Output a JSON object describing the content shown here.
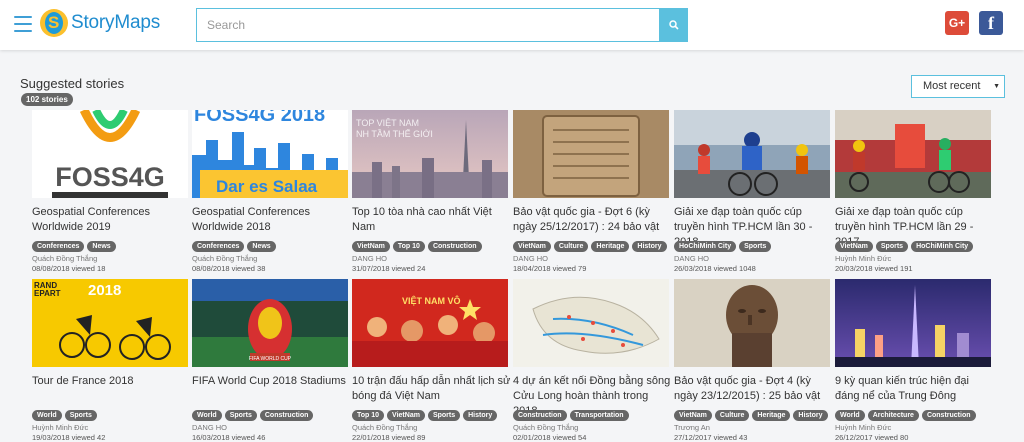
{
  "app": {
    "name": "StoryMaps"
  },
  "header": {
    "search": {
      "placeholder": "Search"
    },
    "social": {
      "gplus_label": "G+",
      "facebook_label": "f"
    }
  },
  "section": {
    "title": "Suggested stories",
    "count_badge": "102 stories",
    "sort": {
      "selected": "Most recent"
    }
  },
  "stories": [
    {
      "title": "Geospatial Conferences Worldwide 2019",
      "tags": [
        "Conferences",
        "News"
      ],
      "author": "Quách Đồng Thắng",
      "meta": "08/08/2018 viewed 18",
      "thumb": "foss4g"
    },
    {
      "title": "Geospatial Conferences Worldwide 2018",
      "tags": [
        "Conferences",
        "News"
      ],
      "author": "Quách Đồng Thắng",
      "meta": "08/08/2018 viewed 38",
      "thumb": "daressalaam"
    },
    {
      "title": "Top 10 tòa nhà cao nhất Việt Nam",
      "tags": [
        "VietNam",
        "Top 10",
        "Construction"
      ],
      "author": "DANG HO",
      "meta": "31/07/2018 viewed 24",
      "thumb": "skyline"
    },
    {
      "title": "Bảo vật quốc gia - Đợt 6 (kỳ ngày 25/12/2017) : 24 bảo vật",
      "tags": [
        "VietNam",
        "Culture",
        "Heritage",
        "History"
      ],
      "author": "DANG HO",
      "meta": "18/04/2018 viewed 79",
      "thumb": "artifact"
    },
    {
      "title": "Giải xe đạp toàn quốc cúp truyền hình TP.HCM lần 30 - 2018",
      "tags": [
        "HoChiMinh City",
        "Sports"
      ],
      "author": "DANG HO",
      "meta": "26/03/2018 viewed 1048",
      "thumb": "cycling1"
    },
    {
      "title": "Giải xe đạp toàn quốc cúp truyền hình TP.HCM lần 29 - 2017",
      "tags": [
        "VietNam",
        "Sports",
        "HoChiMinh City"
      ],
      "author": "Huỳnh Minh Đức",
      "meta": "20/03/2018 viewed 191",
      "thumb": "cycling2"
    },
    {
      "title": "Tour de France 2018",
      "tags": [
        "World",
        "Sports"
      ],
      "author": "Huỳnh Minh Đức",
      "meta": "19/03/2018 viewed 42",
      "thumb": "tdf"
    },
    {
      "title": "FIFA World Cup 2018 Stadiums",
      "tags": [
        "World",
        "Sports",
        "Construction"
      ],
      "author": "DANG HO",
      "meta": "16/03/2018 viewed 46",
      "thumb": "fifa"
    },
    {
      "title": "10 trận đấu hấp dẫn nhất lịch sử bóng đá Việt Nam",
      "tags": [
        "Top 10",
        "VietNam",
        "Sports",
        "History"
      ],
      "author": "Quách Đồng Thắng",
      "meta": "22/01/2018 viewed 89",
      "thumb": "fans"
    },
    {
      "title": "4 dự án kết nối Đồng bằng sông Cửu Long hoàn thành trong 2018",
      "tags": [
        "Construction",
        "Transportation"
      ],
      "author": "Quách Đồng Thắng",
      "meta": "02/01/2018 viewed 54",
      "thumb": "map"
    },
    {
      "title": "Bảo vật quốc gia - Đợt 4 (kỳ ngày 23/12/2015) : 25 bảo vật",
      "tags": [
        "VietNam",
        "Culture",
        "Heritage",
        "History"
      ],
      "author": "Trương An",
      "meta": "27/12/2017 viewed 43",
      "thumb": "statue"
    },
    {
      "title": "9 kỳ quan kiến trúc hiện đại đáng nể của Trung Đông",
      "tags": [
        "World",
        "Architecture",
        "Construction"
      ],
      "author": "Huỳnh Minh Đức",
      "meta": "26/12/2017 viewed 80",
      "thumb": "dubai"
    }
  ]
}
